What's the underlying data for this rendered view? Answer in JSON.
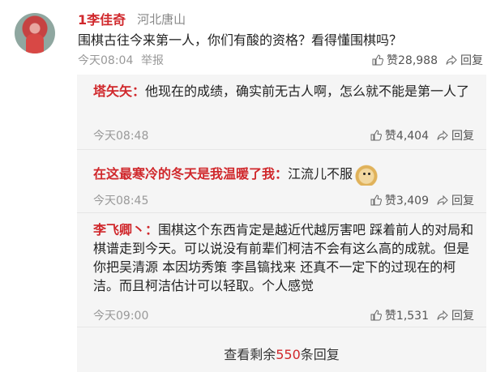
{
  "comment": {
    "user": "1李佳奇",
    "location": "河北唐山",
    "text": "围棋古往今来第一人，你们有酸的资格？看得懂围棋吗？",
    "time": "今天08:04",
    "report": "举报",
    "like_label": "赞28,988",
    "reply_label": "回复"
  },
  "replies": [
    {
      "name": "塔矢矢：",
      "text": "他现在的成绩，确实前无古人啊，怎么就不能是第一人了",
      "time": "今天08:48",
      "like_label": "赞4,404",
      "reply_label": "回复"
    },
    {
      "name": "在这最寒冷的冬天是我温暖了我：",
      "text": "江流儿不服",
      "time": "今天08:45",
      "like_label": "赞3,409",
      "reply_label": "回复"
    },
    {
      "name": "李飞卿丶：",
      "text": "围棋这个东西肯定是越近代越厉害吧 踩着前人的对局和棋谱走到今天。可以说没有前辈们柯洁不会有这么高的成就。但是你把吴清源 本因坊秀策 李昌镐找来 还真不一定下的过现在的柯洁。而且柯洁估计可以轻取。个人感觉",
      "time": "今天09:00",
      "like_label": "赞1,531",
      "reply_label": "回复"
    }
  ],
  "more": {
    "prefix": "查看剩余",
    "count": "550",
    "suffix": "条回复"
  },
  "colors": {
    "name_red": "#d0282c",
    "reply_bg": "#f5f5f5",
    "meta_gray": "#999999"
  },
  "icons": {
    "like": "thumbs-up-icon",
    "reply": "share-arrow-icon",
    "emoji": "doge-emoji-icon"
  }
}
